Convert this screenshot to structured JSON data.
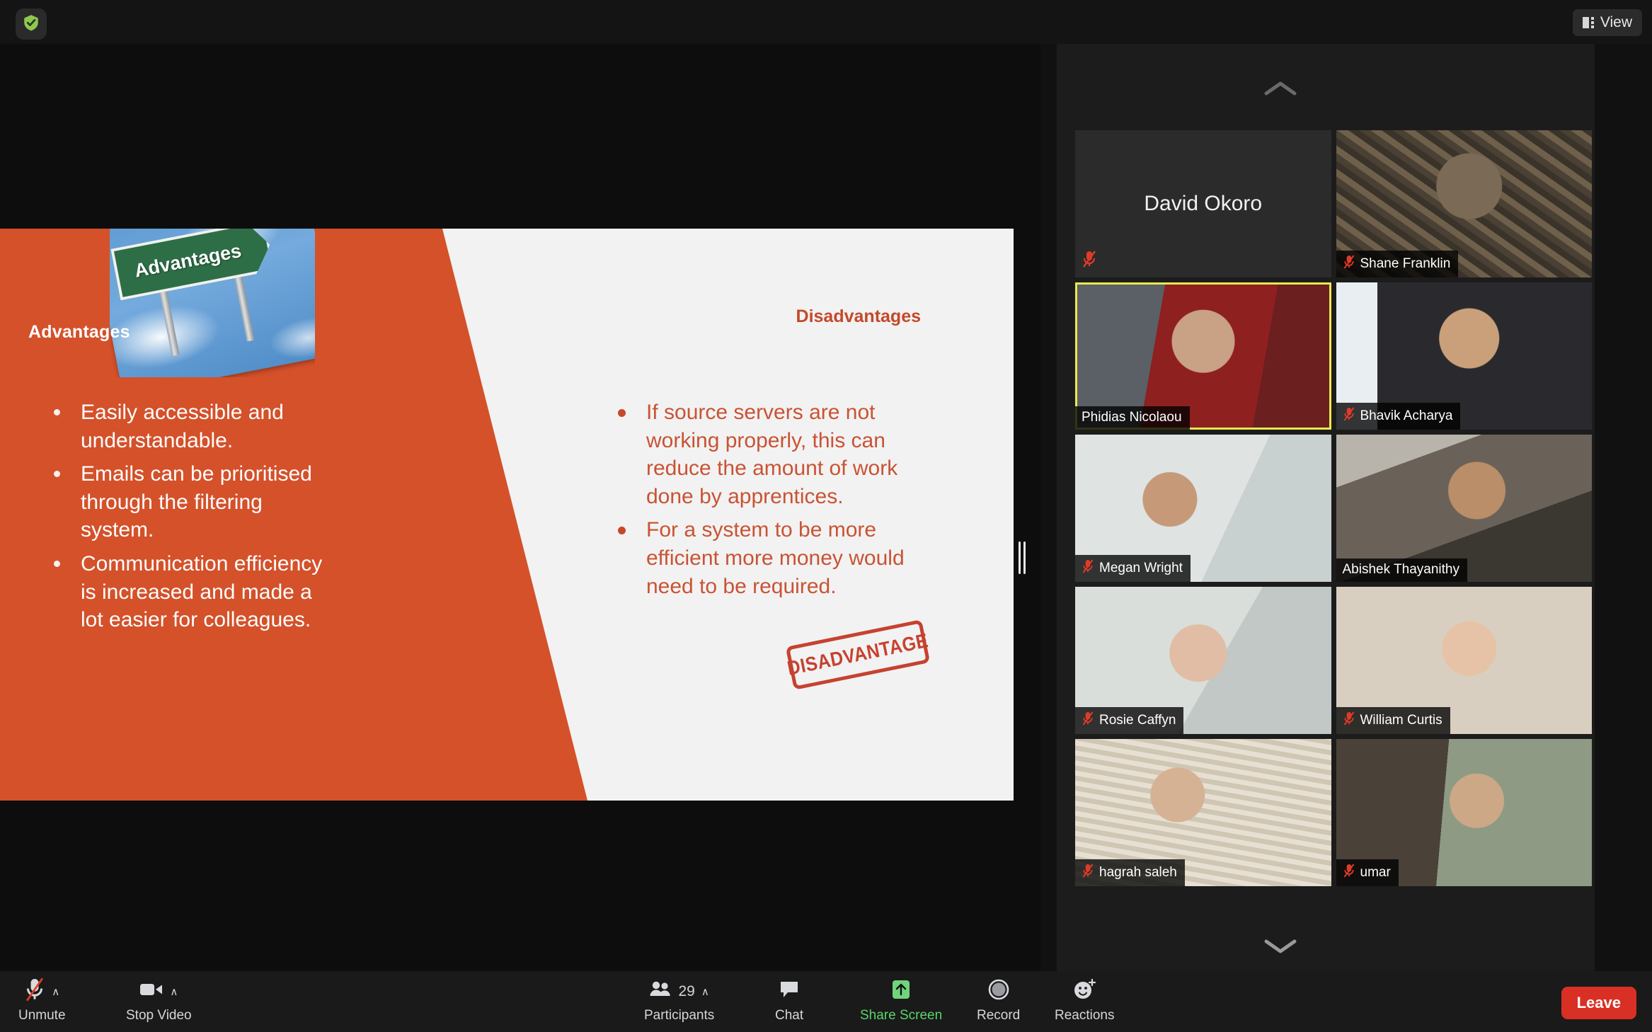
{
  "topbar": {
    "shield_icon": "shield-check-icon",
    "view_label": "View",
    "view_icon": "layout-grid-icon"
  },
  "gallery": {
    "scroll_up_icon": "chevron-up-icon",
    "scroll_down_icon": "chevron-down-icon",
    "participants": [
      {
        "name": "David Okoro",
        "video_off": true,
        "muted": true,
        "active_speaker": false
      },
      {
        "name": "Shane Franklin",
        "video_off": false,
        "muted": true,
        "active_speaker": false
      },
      {
        "name": "Phidias Nicolaou",
        "video_off": false,
        "muted": false,
        "active_speaker": true
      },
      {
        "name": "Bhavik Acharya",
        "video_off": false,
        "muted": true,
        "active_speaker": false
      },
      {
        "name": "Megan Wright",
        "video_off": false,
        "muted": true,
        "active_speaker": false
      },
      {
        "name": "Abishek Thayanithy",
        "video_off": false,
        "muted": false,
        "active_speaker": false
      },
      {
        "name": "Rosie Caffyn",
        "video_off": false,
        "muted": true,
        "active_speaker": false
      },
      {
        "name": "William Curtis",
        "video_off": false,
        "muted": true,
        "active_speaker": false
      },
      {
        "name": "hagrah saleh",
        "video_off": false,
        "muted": true,
        "active_speaker": false
      },
      {
        "name": "umar",
        "video_off": false,
        "muted": true,
        "active_speaker": false
      }
    ]
  },
  "slide": {
    "left_panel": {
      "heading": "Advantages",
      "bullets": [
        "Easily accessible and understandable.",
        "Emails can be prioritised through the filtering system.",
        "Communication efficiency is increased and made a lot easier for colleagues."
      ],
      "sign_image_text": "Advantages",
      "background_color": "#d4512a",
      "text_color": "#ffffff"
    },
    "right_panel": {
      "heading": "Disadvantages",
      "bullets": [
        "If source servers are not working properly, this can reduce the amount of work done by apprentices.",
        "For a system to be more efficient more money would need to be required."
      ],
      "stamp_text": "DISADVANTAGE",
      "background_color": "#f2f2f2",
      "text_color": "#c95334"
    },
    "resize_handle_icon": "drag-handle-icon"
  },
  "toolbar": {
    "mute": {
      "label": "Unmute",
      "icon": "microphone-muted-icon",
      "caret": "∧"
    },
    "video": {
      "label": "Stop Video",
      "icon": "video-camera-icon",
      "caret": "∧"
    },
    "participants": {
      "label": "Participants",
      "icon": "people-icon",
      "count": "29",
      "caret": "∧"
    },
    "chat": {
      "label": "Chat",
      "icon": "chat-bubble-icon"
    },
    "share": {
      "label": "Share Screen",
      "icon": "share-screen-up-arrow-icon",
      "color": "#5ad469"
    },
    "record": {
      "label": "Record",
      "icon": "record-circle-icon"
    },
    "reactions": {
      "label": "Reactions",
      "icon": "smiley-plus-icon"
    },
    "leave": {
      "label": "Leave",
      "color": "#d93025"
    }
  }
}
